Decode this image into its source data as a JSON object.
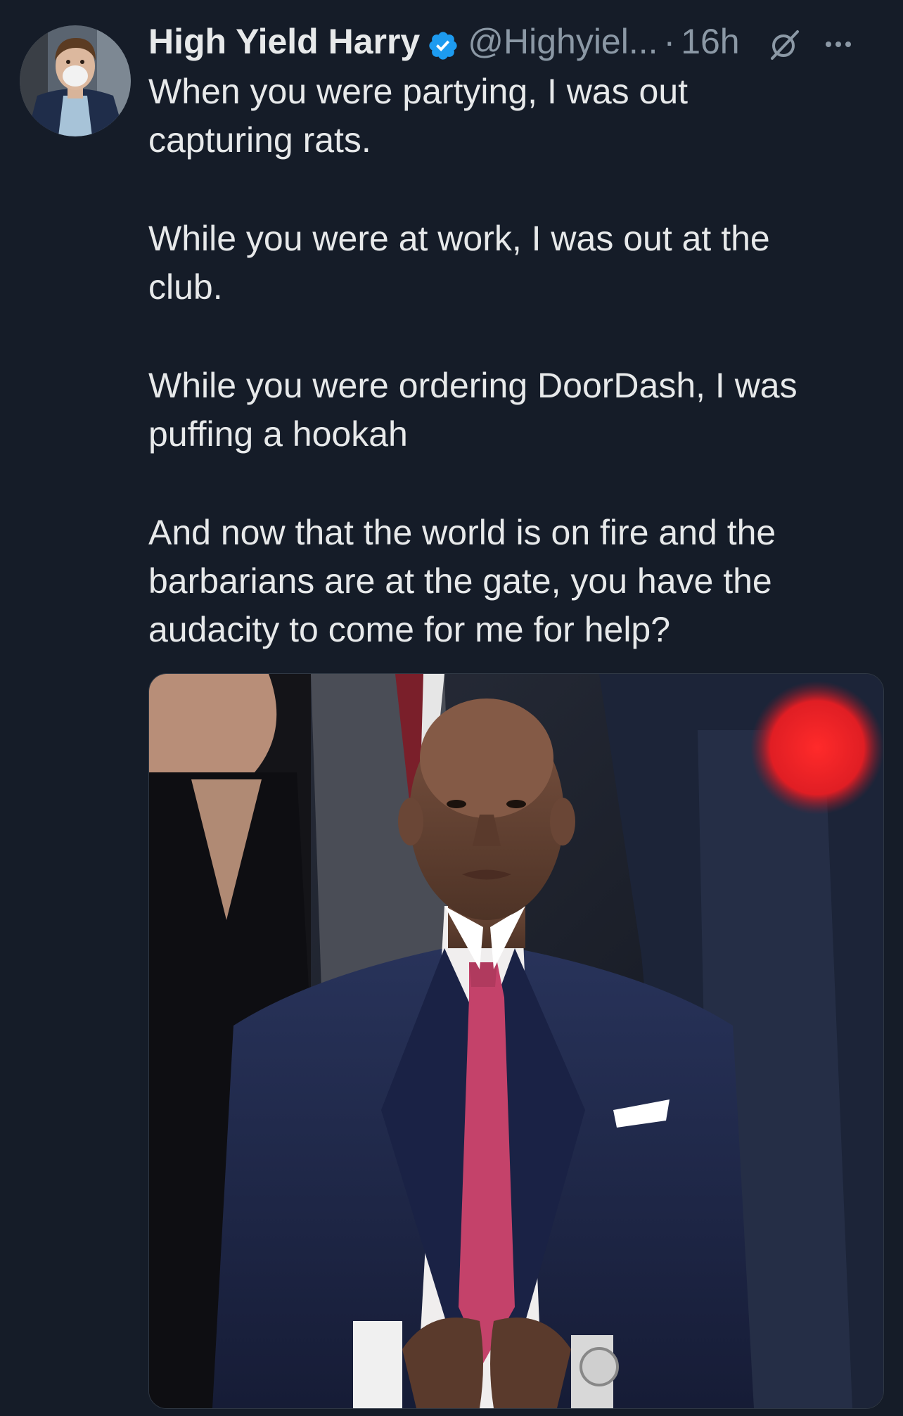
{
  "tweet": {
    "author": {
      "display_name": "High Yield Harry",
      "handle": "@Highyiel...",
      "verified": true,
      "avatar_icon": "avatar-man-mask"
    },
    "separator": "·",
    "timestamp": "16h",
    "icons": {
      "verified": "verified-badge-icon",
      "grok": "grok-icon",
      "more": "more-icon"
    },
    "body": [
      "When you were partying, I was out\ncapturing rats.",
      "While you were at work, I was out at the\nclub.",
      "While you were ordering DoorDash, I was\npuffing a hookah",
      "And now that the world is on fire and the\nbarbarians are at the gate, you have the\naudacity to come for me for help?"
    ],
    "media": {
      "type": "photo"
    }
  },
  "colors": {
    "background": "#151c28",
    "text": "#e7e9ea",
    "muted": "#8b98a5",
    "verified": "#1d9bf0"
  }
}
